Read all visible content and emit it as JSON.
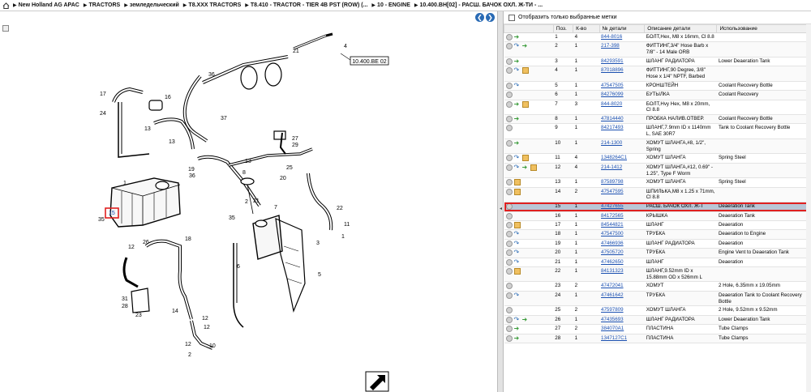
{
  "breadcrumb": [
    "New Holland AG APAC",
    "TRACTORS",
    "земледельческий",
    "T8.XXX TRACTORS",
    "T8.410 - TRACTOR - TIER 4B PST (ROW) (...",
    "10 - ENGINE",
    "10.400.BH[02] - РАСШ. БАЧОК ОХЛ. Ж-ТИ - ..."
  ],
  "diagram": {
    "ref_label": "10.400.BE 02",
    "highlighted_callout": "15",
    "callouts": [
      "1",
      "2",
      "3",
      "4",
      "5",
      "6",
      "7",
      "8",
      "10",
      "11",
      "12",
      "13",
      "14",
      "15",
      "16",
      "17",
      "18",
      "19",
      "20",
      "21",
      "22",
      "23",
      "24",
      "25",
      "26",
      "27",
      "28",
      "29",
      "31",
      "35",
      "36",
      "37"
    ]
  },
  "filter": {
    "label": "Отобразить только выбранные метки"
  },
  "table": {
    "headers": {
      "pos": "Поз.",
      "qty": "К-во",
      "part": "№ детали",
      "desc": "Описание детали",
      "usage": "Использование"
    },
    "rows": [
      {
        "pos": "1",
        "qty": "4",
        "part": "844-8016",
        "desc": "БОЛТ,Hex, M8 x 16mm, Cl 8.8",
        "usage": "",
        "icons": [
          "view",
          "cart"
        ]
      },
      {
        "pos": "2",
        "qty": "1",
        "part": "217-398",
        "desc": "ФИТТИНГ,3/4\" Hose Barb x 7/8\" - 14 Male ORB",
        "usage": "",
        "icons": [
          "view",
          "swap",
          "cart"
        ]
      },
      {
        "pos": "3",
        "qty": "1",
        "part": "84293591",
        "desc": "ШЛАНГ РАДИАТОРА",
        "usage": "Lower Deaeration Tank",
        "icons": [
          "view",
          "cart"
        ]
      },
      {
        "pos": "4",
        "qty": "1",
        "part": "87018896",
        "desc": "ФИТТИНГ,90 Degree, 3/8\" Hose x 1/4\" NPTF, Barbed",
        "usage": "",
        "icons": [
          "view",
          "swap",
          "box"
        ]
      },
      {
        "pos": "5",
        "qty": "1",
        "part": "47547505",
        "desc": "КРОНШТЕЙН",
        "usage": "Coolant Recovery Bottle",
        "icons": [
          "view",
          "swap"
        ]
      },
      {
        "pos": "6",
        "qty": "1",
        "part": "84276099",
        "desc": "БУТЫЛКА",
        "usage": "Coolant Recovery",
        "icons": [
          "view"
        ]
      },
      {
        "pos": "7",
        "qty": "3",
        "part": "844-8020",
        "desc": "БОЛТ,Hvy Hex, M8 x 20mm, Cl 8.8",
        "usage": "",
        "icons": [
          "view",
          "cart",
          "box"
        ]
      },
      {
        "pos": "8",
        "qty": "1",
        "part": "47814440",
        "desc": "ПРОБКА НАЛИВ.ОТВЕР.",
        "usage": "Coolant Recovery Bottle",
        "icons": [
          "view",
          "cart"
        ]
      },
      {
        "pos": "9",
        "qty": "1",
        "part": "84217493",
        "desc": "ШЛАНГ,7.9mm ID x 1140mm L, SAE 30R7",
        "usage": "Tank to Coolant Recovery Bottle",
        "icons": [
          "view"
        ]
      },
      {
        "pos": "10",
        "qty": "1",
        "part": "214-1300",
        "desc": "ХОМУТ ШЛАНГА,#8, 1/2\", Spring",
        "usage": "",
        "icons": [
          "view",
          "cart"
        ]
      },
      {
        "pos": "11",
        "qty": "4",
        "part": "1348264C1",
        "desc": "ХОМУТ ШЛАНГА",
        "usage": "Spring Steel",
        "icons": [
          "view",
          "swap",
          "box"
        ]
      },
      {
        "pos": "12",
        "qty": "4",
        "part": "214-1412",
        "desc": "ХОМУТ ШЛАНГА,#12, 0.69\" - 1.25\", Type F Worm",
        "usage": "",
        "icons": [
          "view",
          "swap",
          "cart",
          "box"
        ]
      },
      {
        "pos": "13",
        "qty": "1",
        "part": "87589798",
        "desc": "ХОМУТ ШЛАНГА",
        "usage": "Spring Steel",
        "icons": [
          "view",
          "box"
        ]
      },
      {
        "pos": "14",
        "qty": "2",
        "part": "47547595",
        "desc": "ШПИЛЬКА,M8 x 1.25 x 71mm, Cl 8.8",
        "usage": "",
        "icons": [
          "view",
          "box"
        ]
      },
      {
        "pos": "15",
        "qty": "1",
        "part": "47427655",
        "desc": "РАСШ. БАЧОК ОХЛ. Ж-Т",
        "usage": "Deaeration Tank",
        "icons": [
          "view"
        ],
        "selected": true
      },
      {
        "pos": "16",
        "qty": "1",
        "part": "84172565",
        "desc": "КРЫШКА",
        "usage": "Deaeration Tank",
        "icons": [
          "view"
        ]
      },
      {
        "pos": "17",
        "qty": "1",
        "part": "84544821",
        "desc": "ШЛАНГ",
        "usage": "Deaeration",
        "icons": [
          "view",
          "box"
        ]
      },
      {
        "pos": "18",
        "qty": "1",
        "part": "47547500",
        "desc": "ТРУБКА",
        "usage": "Deaeration to Engine",
        "icons": [
          "view",
          "swap"
        ]
      },
      {
        "pos": "19",
        "qty": "1",
        "part": "47466936",
        "desc": "ШЛАНГ РАДИАТОРА",
        "usage": "Deaeration",
        "icons": [
          "view",
          "swap"
        ]
      },
      {
        "pos": "20",
        "qty": "1",
        "part": "47505720",
        "desc": "ТРУБКА",
        "usage": "Engine Vent to Deaeration Tank",
        "icons": [
          "view",
          "swap"
        ]
      },
      {
        "pos": "21",
        "qty": "1",
        "part": "47462650",
        "desc": "ШЛАНГ",
        "usage": "Deaeration",
        "icons": [
          "view",
          "swap"
        ]
      },
      {
        "pos": "22",
        "qty": "1",
        "part": "84131323",
        "desc": "ШЛАНГ,9.52mm ID x 15.88mm OD x 526mm L",
        "usage": "",
        "icons": [
          "view",
          "box"
        ]
      },
      {
        "pos": "23",
        "qty": "2",
        "part": "47472041",
        "desc": "ХОМУТ",
        "usage": "2 Hole, 6.35mm x 19.05mm",
        "icons": [
          "view"
        ]
      },
      {
        "pos": "24",
        "qty": "1",
        "part": "47461642",
        "desc": "ТРУБКА",
        "usage": "Deaeration Tank to Coolant Recovery Bottle",
        "icons": [
          "view",
          "swap"
        ]
      },
      {
        "pos": "25",
        "qty": "2",
        "part": "47597809",
        "desc": "ХОМУТ ШЛАНГА",
        "usage": "2 Hole, 9.52mm x 9.52mm",
        "icons": [
          "view"
        ]
      },
      {
        "pos": "26",
        "qty": "1",
        "part": "47435693",
        "desc": "ШЛАНГ РАДИАТОРА",
        "usage": "Lower Deaeration Tank",
        "icons": [
          "view",
          "swap",
          "cart"
        ]
      },
      {
        "pos": "27",
        "qty": "2",
        "part": "384070A1",
        "desc": "ПЛАСТИНА",
        "usage": "Tube Clamps",
        "icons": [
          "view",
          "cart"
        ]
      },
      {
        "pos": "28",
        "qty": "1",
        "part": "1347127C1",
        "desc": "ПЛАСТИНА",
        "usage": "Tube Clamps",
        "icons": [
          "view",
          "cart"
        ]
      }
    ]
  },
  "colors": {
    "link": "#1a4fb0",
    "selected_row": "#b9c6d6",
    "highlight": "#e02020",
    "nav": "#2a6bb5"
  }
}
